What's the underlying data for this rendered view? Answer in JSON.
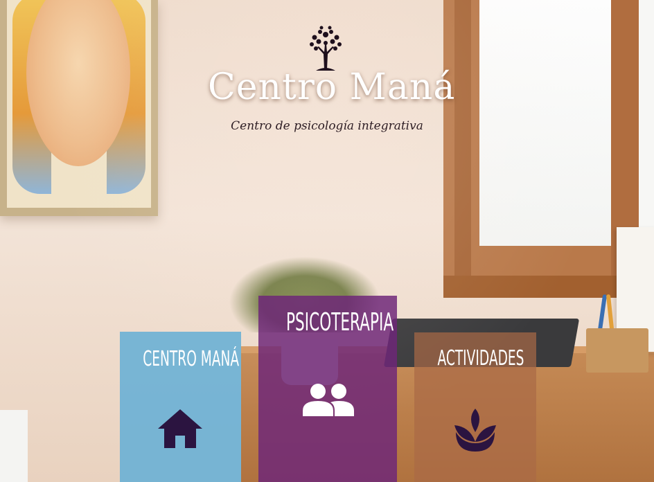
{
  "brand": {
    "title": "Centro Maná",
    "tagline": "Centro de psicología integrativa",
    "logo_icon": "tree-icon"
  },
  "tiles": [
    {
      "label": "CENTRO MANÁ",
      "icon": "home-icon",
      "color": "#6ab0d5"
    },
    {
      "label": "PSICOTERAPIA",
      "icon": "people-icon",
      "color": "#6e2678"
    },
    {
      "label": "ACTIVIDADES",
      "icon": "lotus-icon",
      "color": "#aa6946"
    }
  ],
  "colors": {
    "tile_icon_dark": "#2b1440",
    "tile_text": "#ffffff",
    "tagline_text": "#2d1d24"
  }
}
